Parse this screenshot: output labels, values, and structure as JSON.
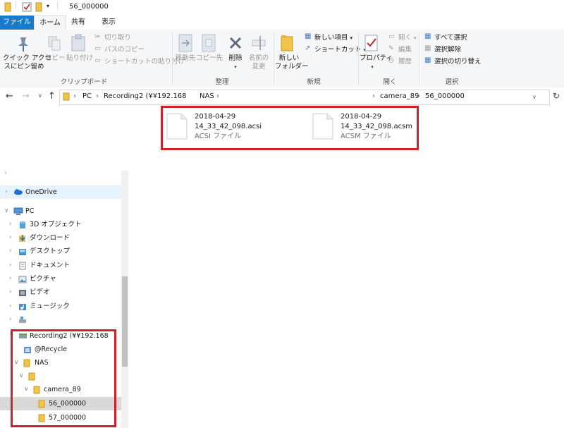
{
  "window": {
    "title": "56_000000"
  },
  "tabs": {
    "file": "ファイル",
    "home": "ホーム",
    "share": "共有",
    "view": "表示"
  },
  "ribbon": {
    "clipboard": {
      "pin_line1": "クイック アクセ",
      "pin_line2": "スにピン留め",
      "copy": "コピー",
      "paste": "貼り付け",
      "cut": "切り取り",
      "copy_path": "パスのコピー",
      "paste_shortcut": "ショートカットの貼り付け",
      "group": "クリップボード"
    },
    "organize": {
      "move_to": "移動先",
      "copy_to": "コピー先",
      "delete": "削除",
      "rename_line1": "名前の",
      "rename_line2": "変更",
      "group": "整理"
    },
    "new": {
      "new_folder_line1": "新しい",
      "new_folder_line2": "フォルダー",
      "new_item": "新しい項目",
      "shortcut": "ショートカット",
      "group": "新規"
    },
    "open": {
      "properties": "プロパティ",
      "open": "開く",
      "edit": "編集",
      "history": "履歴",
      "group": "開く"
    },
    "select": {
      "select_all": "すべて選択",
      "select_none": "選択解除",
      "invert": "選択の切り替え",
      "group": "選択"
    }
  },
  "address": {
    "crumbs": [
      "PC",
      "Recording2 (¥¥192.168",
      "NAS",
      "camera_89",
      "56_000000"
    ]
  },
  "nav": {
    "onedrive": "OneDrive",
    "pc": "PC",
    "objects3d": "3D オブジェクト",
    "downloads": "ダウンロード",
    "desktop": "デスクトップ",
    "documents": "ドキュメント",
    "pictures": "ピクチャ",
    "videos": "ビデオ",
    "music": "ミュージック",
    "recording2": "Recording2 (¥¥192.168",
    "recycle": "@Recycle",
    "nas": "NAS",
    "camera": "camera_89",
    "f56": "56_000000",
    "f57": "57_000000"
  },
  "files": [
    {
      "name_line1": "2018-04-29",
      "name_line2": "14_33_42_098.acsi",
      "type": "ACSI ファイル"
    },
    {
      "name_line1": "2018-04-29",
      "name_line2": "14_33_42_098.acsm",
      "type": "ACSM ファイル"
    }
  ],
  "colors": {
    "accent": "#1979ca",
    "highlight": "#d0202a",
    "folder": "#f0c34a"
  }
}
